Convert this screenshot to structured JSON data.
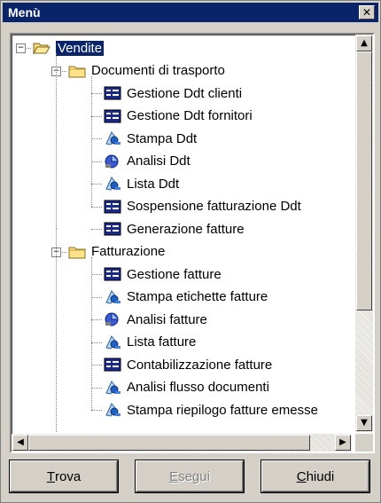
{
  "window": {
    "title": "Menù",
    "close_glyph": "✕"
  },
  "tree": {
    "root": {
      "label": "Vendite",
      "icon": "open-folder-icon",
      "expanded": true
    },
    "groups": [
      {
        "label": "Documenti di trasporto",
        "icon": "folder-icon",
        "expanded": true,
        "items": [
          {
            "label": "Gestione Ddt clienti",
            "icon": "form-icon"
          },
          {
            "label": "Gestione Ddt fornitori",
            "icon": "form-icon"
          },
          {
            "label": "Stampa Ddt",
            "icon": "report-icon"
          },
          {
            "label": "Analisi Ddt",
            "icon": "analysis-icon"
          },
          {
            "label": "Lista Ddt",
            "icon": "report-icon"
          },
          {
            "label": "Sospensione fatturazione Ddt",
            "icon": "form-icon"
          },
          {
            "label": "Generazione fatture",
            "icon": "form-icon"
          }
        ]
      },
      {
        "label": "Fatturazione",
        "icon": "folder-icon",
        "expanded": true,
        "items": [
          {
            "label": "Gestione fatture",
            "icon": "form-icon"
          },
          {
            "label": "Stampa etichette fatture",
            "icon": "report-icon"
          },
          {
            "label": "Analisi fatture",
            "icon": "analysis-icon"
          },
          {
            "label": "Lista fatture",
            "icon": "report-icon"
          },
          {
            "label": "Contabilizzazione fatture",
            "icon": "form-icon"
          },
          {
            "label": "Analisi flusso documenti",
            "icon": "report-icon"
          },
          {
            "label": "Stampa riepilogo fatture emesse",
            "icon": "report-icon"
          }
        ]
      }
    ]
  },
  "buttons": {
    "trova": {
      "accel": "T",
      "rest": "rova"
    },
    "esegui": {
      "accel": "E",
      "rest": "segui"
    },
    "chiudi": {
      "accel": "C",
      "rest": "hiudi"
    }
  },
  "colors": {
    "selection": "#0a246a",
    "titlebar": "#0a246a",
    "face": "#d4d0c8"
  }
}
